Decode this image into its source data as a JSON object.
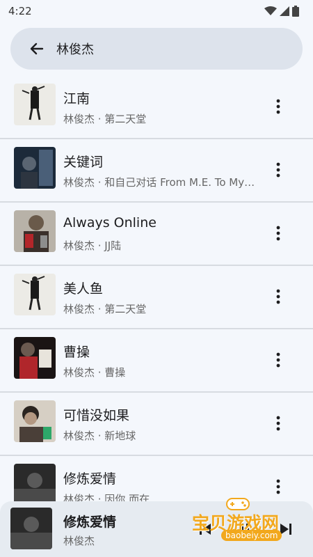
{
  "status_bar": {
    "time": "4:22",
    "icons": [
      "wifi-icon",
      "signal-icon",
      "battery-icon"
    ]
  },
  "search": {
    "query": "林俊杰",
    "back_icon": "arrow-left-icon"
  },
  "songs": [
    {
      "title": "江南",
      "subtitle": "林俊杰 · 第二天堂"
    },
    {
      "title": "关键词",
      "subtitle": "林俊杰 · 和自己对话 From M.E. To Myself"
    },
    {
      "title": "Always Online",
      "subtitle": "林俊杰 · JJ陆"
    },
    {
      "title": "美人鱼",
      "subtitle": "林俊杰 · 第二天堂"
    },
    {
      "title": "曹操",
      "subtitle": "林俊杰 · 曹操"
    },
    {
      "title": "可惜没如果",
      "subtitle": "林俊杰 · 新地球"
    },
    {
      "title": "修炼爱情",
      "subtitle": "林俊杰 · 因你 而在"
    }
  ],
  "now_playing": {
    "title": "修炼爱情",
    "artist": "林俊杰",
    "controls": [
      "skip-previous-icon",
      "play-pause-icon",
      "skip-next-icon"
    ]
  },
  "watermark": {
    "text": "宝贝游戏网",
    "url": "baobeiy.com"
  },
  "colors": {
    "background": "#f4f7fc",
    "search_bg": "#dde3ec",
    "divider": "#d7dbe1",
    "mini_player_bg": "#e6ebf1",
    "watermark": "#f2a81d"
  }
}
